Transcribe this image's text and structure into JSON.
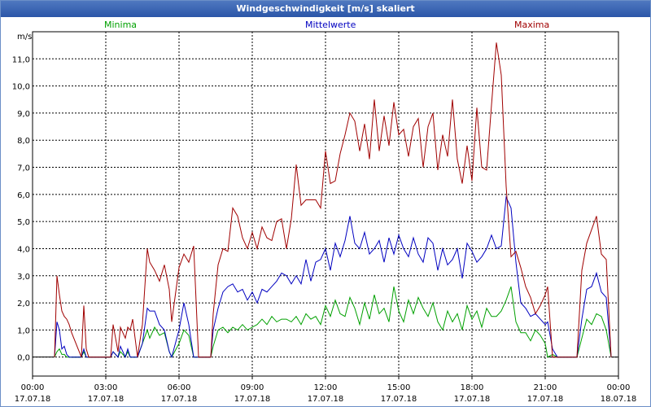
{
  "window": {
    "title": "Windgeschwindigkeit [m/s] skaliert"
  },
  "chart_data": {
    "type": "line",
    "title": "Windgeschwindigkeit [m/s] skaliert",
    "ylabel": "m/s",
    "ylim": [
      -0.7,
      12.0
    ],
    "y_ticks": [
      "0,0",
      "1,0",
      "2,0",
      "3,0",
      "4,0",
      "5,0",
      "6,0",
      "7,0",
      "8,0",
      "9,0",
      "10,0",
      "11,0"
    ],
    "x_range_hours": [
      0,
      24
    ],
    "x_ticks": [
      {
        "time": "00:00",
        "date": "17.07.18"
      },
      {
        "time": "03:00",
        "date": "17.07.18"
      },
      {
        "time": "06:00",
        "date": "17.07.18"
      },
      {
        "time": "09:00",
        "date": "17.07.18"
      },
      {
        "time": "12:00",
        "date": "17.07.18"
      },
      {
        "time": "15:00",
        "date": "17.07.18"
      },
      {
        "time": "18:00",
        "date": "17.07.18"
      },
      {
        "time": "21:00",
        "date": "17.07.18"
      },
      {
        "time": "00:00",
        "date": "18.07.18"
      }
    ],
    "grid": true,
    "legend_placement": "top",
    "series": [
      {
        "name": "Minima",
        "color": "#00a000",
        "x": [
          0.9,
          1.0,
          1.1,
          1.2,
          1.3,
          1.4,
          1.5,
          1.6,
          2.0,
          2.1,
          2.2,
          2.3,
          3.2,
          3.3,
          3.5,
          3.6,
          3.8,
          3.9,
          4.0,
          4.1,
          4.3,
          4.5,
          4.7,
          4.8,
          5.0,
          5.2,
          5.4,
          5.6,
          5.7,
          6.0,
          6.2,
          6.4,
          6.6,
          6.8,
          7.3,
          7.4,
          7.6,
          7.8,
          8.0,
          8.2,
          8.4,
          8.6,
          8.8,
          9.0,
          9.2,
          9.4,
          9.6,
          9.8,
          10.0,
          10.2,
          10.4,
          10.6,
          10.8,
          11.0,
          11.2,
          11.4,
          11.6,
          11.8,
          12.0,
          12.2,
          12.4,
          12.6,
          12.8,
          13.0,
          13.2,
          13.4,
          13.6,
          13.8,
          14.0,
          14.2,
          14.4,
          14.6,
          14.8,
          15.0,
          15.2,
          15.4,
          15.6,
          15.8,
          16.0,
          16.2,
          16.4,
          16.6,
          16.8,
          17.0,
          17.2,
          17.4,
          17.6,
          17.8,
          18.0,
          18.2,
          18.4,
          18.6,
          18.8,
          19.0,
          19.2,
          19.4,
          19.6,
          19.8,
          20.0,
          20.2,
          20.4,
          20.6,
          20.8,
          21.0,
          21.1,
          21.3,
          21.5,
          21.7,
          21.9,
          22.1,
          22.3,
          22.5,
          22.7,
          22.9,
          23.1,
          23.3,
          23.5,
          23.7
        ],
        "values": [
          0.0,
          0.2,
          0.3,
          0.1,
          0.1,
          0.0,
          0.0,
          0.0,
          0.0,
          0.2,
          0.0,
          0.0,
          0.0,
          0.2,
          0.0,
          0.2,
          0.0,
          0.2,
          0.0,
          0.0,
          0.0,
          0.5,
          1.0,
          0.7,
          1.1,
          0.8,
          0.9,
          0.2,
          0.0,
          0.5,
          1.0,
          0.8,
          0.0,
          0.0,
          0.0,
          0.4,
          1.0,
          1.1,
          0.9,
          1.1,
          1.0,
          1.2,
          1.0,
          1.1,
          1.2,
          1.4,
          1.2,
          1.5,
          1.3,
          1.4,
          1.4,
          1.3,
          1.5,
          1.2,
          1.6,
          1.4,
          1.5,
          1.2,
          1.9,
          1.5,
          2.1,
          1.6,
          1.5,
          2.2,
          1.8,
          1.2,
          2.0,
          1.4,
          2.3,
          1.6,
          1.8,
          1.3,
          2.6,
          1.7,
          1.3,
          2.1,
          1.6,
          2.2,
          1.8,
          1.5,
          2.0,
          1.3,
          1.0,
          1.7,
          1.3,
          1.6,
          1.0,
          1.9,
          1.4,
          1.7,
          1.1,
          1.8,
          1.5,
          1.5,
          1.7,
          2.1,
          2.6,
          1.3,
          0.9,
          0.9,
          0.6,
          1.0,
          0.8,
          0.5,
          0.0,
          0.1,
          0.0,
          0.0,
          0.0,
          0.0,
          0.0,
          0.7,
          1.4,
          1.2,
          1.6,
          1.5,
          1.0,
          0.0
        ],
        "values_note": null
      },
      {
        "name": "Mittelwerte",
        "color": "#0000c0",
        "x": [
          0.9,
          1.0,
          1.1,
          1.2,
          1.3,
          1.4,
          1.5,
          1.6,
          2.0,
          2.1,
          2.2,
          2.3,
          3.2,
          3.3,
          3.5,
          3.6,
          3.8,
          3.9,
          4.0,
          4.1,
          4.3,
          4.5,
          4.7,
          4.8,
          5.0,
          5.2,
          5.4,
          5.6,
          5.7,
          6.0,
          6.2,
          6.4,
          6.6,
          6.8,
          7.3,
          7.4,
          7.6,
          7.8,
          8.0,
          8.2,
          8.4,
          8.6,
          8.8,
          9.0,
          9.2,
          9.4,
          9.6,
          9.8,
          10.0,
          10.2,
          10.4,
          10.6,
          10.8,
          11.0,
          11.2,
          11.4,
          11.6,
          11.8,
          12.0,
          12.2,
          12.4,
          12.6,
          12.8,
          13.0,
          13.2,
          13.4,
          13.6,
          13.8,
          14.0,
          14.2,
          14.4,
          14.6,
          14.8,
          15.0,
          15.2,
          15.4,
          15.6,
          15.8,
          16.0,
          16.2,
          16.4,
          16.6,
          16.8,
          17.0,
          17.2,
          17.4,
          17.6,
          17.8,
          18.0,
          18.2,
          18.4,
          18.6,
          18.8,
          19.0,
          19.2,
          19.4,
          19.6,
          19.8,
          20.0,
          20.2,
          20.4,
          20.6,
          20.8,
          21.0,
          21.1,
          21.3,
          21.5,
          21.7,
          21.9,
          22.1,
          22.3,
          22.5,
          22.7,
          22.9,
          23.1,
          23.3,
          23.5,
          23.7
        ],
        "values": [
          0.0,
          1.3,
          1.0,
          0.3,
          0.4,
          0.1,
          0.0,
          0.0,
          0.0,
          0.3,
          0.0,
          0.0,
          0.0,
          0.2,
          0.0,
          0.4,
          0.0,
          0.3,
          0.0,
          0.0,
          0.0,
          0.5,
          1.8,
          1.7,
          1.7,
          1.2,
          1.0,
          0.2,
          0.0,
          1.0,
          2.0,
          1.2,
          0.0,
          0.0,
          0.0,
          1.0,
          1.8,
          2.4,
          2.6,
          2.7,
          2.4,
          2.5,
          2.1,
          2.4,
          2.0,
          2.5,
          2.4,
          2.6,
          2.8,
          3.1,
          3.0,
          2.7,
          3.0,
          2.7,
          3.6,
          2.8,
          3.5,
          3.6,
          4.0,
          3.2,
          4.2,
          3.7,
          4.3,
          5.2,
          4.2,
          4.0,
          4.6,
          3.8,
          4.0,
          4.3,
          3.5,
          4.4,
          3.8,
          4.5,
          4.0,
          3.7,
          4.4,
          3.8,
          3.5,
          4.4,
          4.2,
          3.2,
          4.0,
          3.4,
          3.6,
          4.0,
          2.9,
          4.2,
          3.9,
          3.5,
          3.7,
          4.0,
          4.5,
          4.0,
          4.1,
          5.9,
          5.5,
          3.5,
          2.0,
          1.8,
          1.5,
          1.6,
          1.4,
          1.2,
          1.3,
          0.3,
          0.0,
          0.0,
          0.0,
          0.0,
          0.0,
          1.4,
          2.5,
          2.6,
          3.1,
          2.4,
          2.2,
          0.0
        ],
        "values_note": null
      },
      {
        "name": "Maxima",
        "color": "#a00000",
        "x": [
          0.9,
          1.0,
          1.1,
          1.2,
          1.3,
          1.4,
          1.5,
          1.6,
          2.0,
          2.1,
          2.2,
          2.3,
          3.2,
          3.3,
          3.5,
          3.6,
          3.8,
          3.9,
          4.0,
          4.1,
          4.3,
          4.5,
          4.7,
          4.8,
          5.0,
          5.2,
          5.4,
          5.6,
          5.7,
          6.0,
          6.2,
          6.4,
          6.6,
          6.8,
          7.3,
          7.4,
          7.6,
          7.8,
          8.0,
          8.2,
          8.4,
          8.6,
          8.8,
          9.0,
          9.2,
          9.4,
          9.6,
          9.8,
          10.0,
          10.2,
          10.4,
          10.6,
          10.8,
          11.0,
          11.2,
          11.4,
          11.6,
          11.8,
          12.0,
          12.2,
          12.4,
          12.6,
          12.8,
          13.0,
          13.2,
          13.4,
          13.6,
          13.8,
          14.0,
          14.2,
          14.4,
          14.6,
          14.8,
          15.0,
          15.2,
          15.4,
          15.6,
          15.8,
          16.0,
          16.2,
          16.4,
          16.6,
          16.8,
          17.0,
          17.2,
          17.4,
          17.6,
          17.8,
          18.0,
          18.2,
          18.4,
          18.6,
          18.8,
          19.0,
          19.2,
          19.4,
          19.6,
          19.8,
          20.0,
          20.2,
          20.4,
          20.6,
          20.8,
          21.0,
          21.1,
          21.3,
          21.5,
          21.7,
          21.9,
          22.1,
          22.3,
          22.5,
          22.7,
          22.9,
          23.1,
          23.3,
          23.5,
          23.7
        ],
        "values": [
          0.0,
          3.0,
          2.3,
          1.7,
          1.5,
          1.4,
          1.2,
          0.9,
          0.0,
          1.9,
          0.3,
          0.0,
          0.0,
          1.2,
          0.2,
          1.1,
          0.7,
          1.1,
          1.0,
          1.4,
          0.0,
          1.2,
          4.0,
          3.5,
          3.2,
          2.8,
          3.4,
          2.5,
          1.3,
          3.3,
          3.8,
          3.5,
          4.1,
          0.0,
          0.0,
          1.6,
          3.4,
          4.0,
          3.9,
          5.5,
          5.2,
          4.4,
          4.0,
          4.6,
          4.0,
          4.8,
          4.4,
          4.3,
          5.0,
          5.1,
          4.0,
          5.1,
          7.1,
          5.6,
          5.8,
          5.8,
          5.8,
          5.5,
          7.6,
          6.4,
          6.5,
          7.5,
          8.2,
          9.0,
          8.7,
          7.6,
          8.6,
          7.3,
          9.5,
          7.6,
          8.9,
          7.8,
          9.4,
          8.2,
          8.4,
          7.4,
          8.5,
          8.8,
          7.0,
          8.5,
          9.0,
          6.9,
          8.2,
          7.4,
          9.5,
          7.3,
          6.4,
          7.8,
          6.5,
          9.2,
          7.0,
          6.9,
          9.3,
          11.6,
          10.4,
          6.3,
          3.7,
          3.9,
          3.3,
          2.6,
          2.2,
          1.6,
          1.9,
          2.3,
          2.6,
          0.0,
          0.0,
          0.0,
          0.0,
          0.0,
          0.0,
          3.2,
          4.2,
          4.7,
          5.2,
          3.8,
          3.6,
          0.0
        ],
        "values_note": null
      }
    ]
  }
}
